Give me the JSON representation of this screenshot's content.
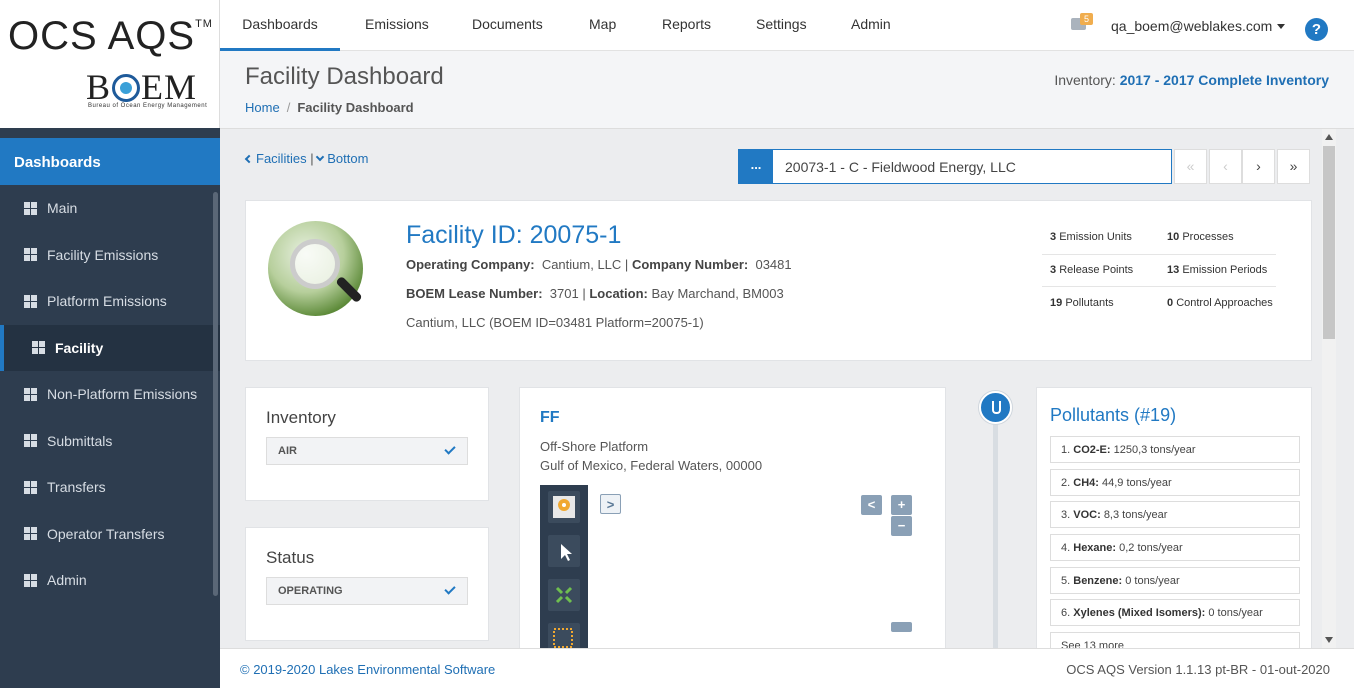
{
  "logo": {
    "ocs": "OCS AQS",
    "tm": "TM",
    "boem_b": "B",
    "boem_em": "EM",
    "boem_sub": "Bureau of Ocean Energy Management"
  },
  "sidebar": {
    "header": "Dashboards",
    "items": [
      {
        "label": "Main"
      },
      {
        "label": "Facility Emissions"
      },
      {
        "label": "Platform Emissions"
      },
      {
        "label": "Facility",
        "active": true
      },
      {
        "label": "Non-Platform Emissions"
      },
      {
        "label": "Submittals"
      },
      {
        "label": "Transfers"
      },
      {
        "label": "Operator Transfers"
      },
      {
        "label": "Admin"
      }
    ]
  },
  "topnav": {
    "tabs": [
      "Dashboards",
      "Emissions",
      "Documents",
      "Map",
      "Reports",
      "Settings",
      "Admin"
    ],
    "active_tab": "Dashboards",
    "mail_count": "5",
    "user": "qa_boem@weblakes.com",
    "help": "?"
  },
  "page": {
    "title": "Facility Dashboard",
    "breadcrumb": {
      "home": "Home",
      "sep": "/",
      "current": "Facility Dashboard"
    },
    "inventory_label": "Inventory:",
    "inventory_value": "2017 - 2017 Complete Inventory"
  },
  "nav": {
    "facilities": "Facilities",
    "sep": "|",
    "bottom": "Bottom",
    "selector_button": "...",
    "selector_value": "20073-1 - C - Fieldwood Energy, LLC",
    "pager": [
      "«",
      "‹",
      "›",
      "»"
    ]
  },
  "facility": {
    "id_label": "Facility ID: 20075-1",
    "operating_company_label": "Operating Company:",
    "operating_company": "Cantium, LLC",
    "sep": "|",
    "company_number_label": "Company Number:",
    "company_number": "03481",
    "lease_label": "BOEM Lease Number:",
    "lease": "3701",
    "location_label": "Location:",
    "location": "Bay Marchand, BM003",
    "description": "Cantium, LLC (BOEM ID=03481 Platform=20075-1)",
    "stats": [
      {
        "n": "3",
        "label": "Emission Units"
      },
      {
        "n": "10",
        "label": "Processes"
      },
      {
        "n": "3",
        "label": "Release Points"
      },
      {
        "n": "13",
        "label": "Emission Periods"
      },
      {
        "n": "19",
        "label": "Pollutants"
      },
      {
        "n": "0",
        "label": "Control Approaches"
      }
    ]
  },
  "inventory_card": {
    "title": "Inventory",
    "value": "AIR"
  },
  "status_card": {
    "title": "Status",
    "value": "OPERATING"
  },
  "ff_card": {
    "name": "FF",
    "line1": "Off-Shore Platform",
    "line2": "Gulf of Mexico, Federal Waters, 00000",
    "expand": ">",
    "collapse": "<",
    "zoom_in": "+",
    "zoom_out": "−"
  },
  "pollutants": {
    "title": "Pollutants (#19)",
    "items": [
      {
        "idx": "1.",
        "name": "CO2-E:",
        "value": "1250,3 tons/year"
      },
      {
        "idx": "2.",
        "name": "CH4:",
        "value": "44,9 tons/year"
      },
      {
        "idx": "3.",
        "name": "VOC:",
        "value": "8,3 tons/year"
      },
      {
        "idx": "4.",
        "name": "Hexane:",
        "value": "0,2 tons/year"
      },
      {
        "idx": "5.",
        "name": "Benzene:",
        "value": "0 tons/year"
      },
      {
        "idx": "6.",
        "name": "Xylenes (Mixed Isomers):",
        "value": "0 tons/year"
      }
    ],
    "more": "See 13 more"
  },
  "footer": {
    "copyright": "© 2019-2020 Lakes Environmental Software",
    "version": "OCS AQS Version 1.1.13 pt-BR - 01-out-2020"
  },
  "colors": {
    "accent": "#2179c3",
    "sidebar": "#2e3d4f",
    "badge": "#f0ad4e"
  }
}
